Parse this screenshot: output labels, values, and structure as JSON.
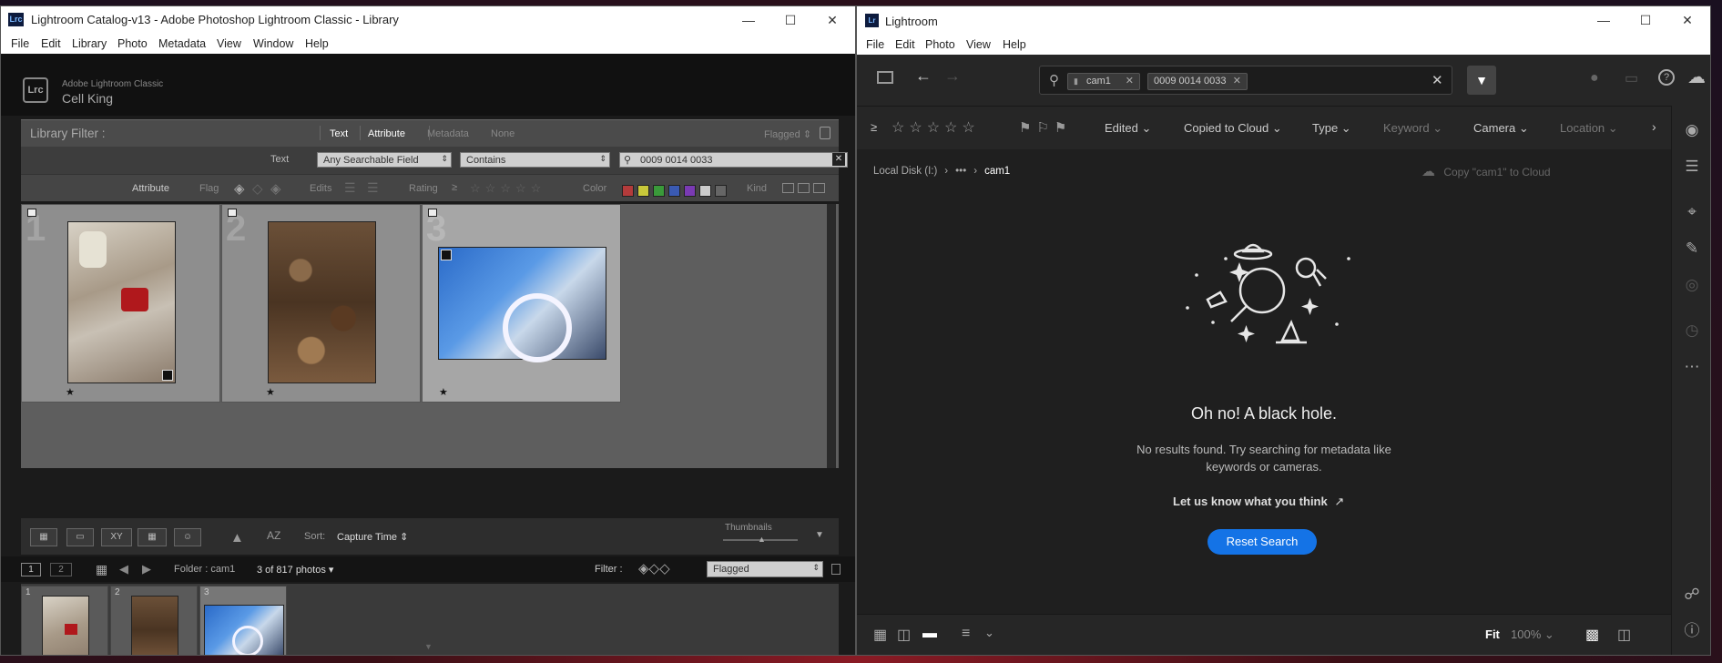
{
  "lrc": {
    "title": "Lightroom Catalog-v13 - Adobe Photoshop Lightroom Classic - Library",
    "app_icon": "Lrc",
    "menu": [
      "File",
      "Edit",
      "Library",
      "Photo",
      "Metadata",
      "View",
      "Window",
      "Help"
    ],
    "brand_top": "Adobe Lightroom Classic",
    "brand_name": "Cell King",
    "badge": "Lrc",
    "filter": {
      "label": "Library Filter :",
      "tabs": [
        "Text",
        "Attribute",
        "Metadata",
        "None"
      ],
      "preset": "Flagged",
      "text_label": "Text",
      "field_dropdown": "Any Searchable Field",
      "rule_dropdown": "Contains",
      "search_value": "0009 0014 0033",
      "attr_label": "Attribute",
      "flag_label": "Flag",
      "edits_label": "Edits",
      "rating_label": "Rating",
      "rating_op": "≥",
      "color_label": "Color",
      "kind_label": "Kind",
      "swatch_colors": [
        "#b33b3b",
        "#c8c83a",
        "#3a9a3a",
        "#3a5ab3",
        "#7a3ab3",
        "#cccccc",
        "#666666"
      ]
    },
    "grid": [
      {
        "num": "1",
        "star": "★"
      },
      {
        "num": "2",
        "star": "★"
      },
      {
        "num": "3",
        "star": "★"
      }
    ],
    "toolbar": {
      "sort_label": "Sort:",
      "sort_value": "Capture Time",
      "thumbnails_label": "Thumbnails"
    },
    "filmstrip_bar": {
      "page1": "1",
      "page2": "2",
      "folder": "Folder : cam1",
      "count": "3 of 817 photos",
      "filter_label": "Filter :",
      "filter_value": "Flagged"
    },
    "filmstrip": [
      {
        "n": "1"
      },
      {
        "n": "2"
      },
      {
        "n": "3"
      }
    ]
  },
  "lr": {
    "title": "Lightroom",
    "app_icon": "Lr",
    "menu": [
      "File",
      "Edit",
      "Photo",
      "View",
      "Help"
    ],
    "search_chips": [
      "cam1",
      "0009 0014 0033"
    ],
    "filters": [
      "Edited",
      "Copied to Cloud",
      "Type",
      "Keyword",
      "Camera",
      "Location"
    ],
    "rating_op": "≥",
    "breadcrumb": {
      "root": "Local Disk (I:)",
      "ellipsis": "•••",
      "current": "cam1"
    },
    "copy_label": "Copy \"cam1\" to Cloud",
    "empty": {
      "heading": "Oh no! A black hole.",
      "line1": "No results found. Try searching for metadata like",
      "line2": "keywords or cameras.",
      "feedback": "Let us know what you think",
      "button": "Reset Search"
    },
    "bottom": {
      "fit": "Fit",
      "zoom": "100%"
    }
  }
}
